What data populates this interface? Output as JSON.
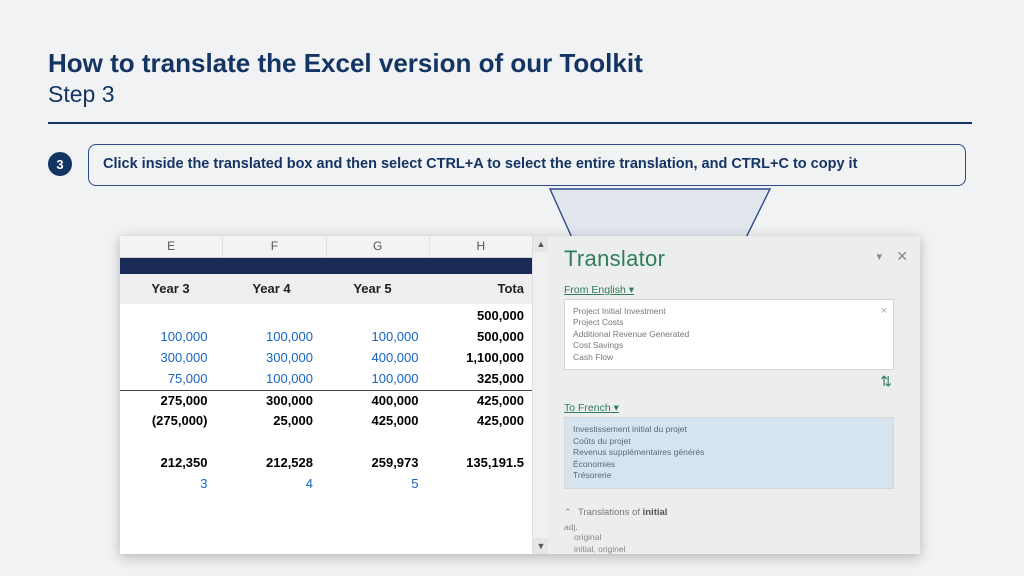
{
  "title": "How to translate the Excel version of our Toolkit",
  "subtitle": "Step 3",
  "step_number": "3",
  "instruction": "Click inside the translated box and then select CTRL+A to select the entire translation, and CTRL+C to copy it",
  "grid": {
    "col_letters": [
      "E",
      "F",
      "G",
      "H"
    ],
    "headers": [
      "Year 3",
      "Year 4",
      "Year 5",
      "Tota"
    ],
    "rows": [
      {
        "cells": [
          "",
          "",
          "",
          "500,000"
        ],
        "style": "bold"
      },
      {
        "cells": [
          "100,000",
          "100,000",
          "100,000",
          "500,000"
        ],
        "style": "blue"
      },
      {
        "cells": [
          "300,000",
          "300,000",
          "400,000",
          "1,100,000"
        ],
        "style": "blue"
      },
      {
        "cells": [
          "75,000",
          "100,000",
          "100,000",
          "325,000"
        ],
        "style": "blue"
      },
      {
        "cells": [
          "275,000",
          "300,000",
          "400,000",
          "425,000"
        ],
        "style": "bold",
        "sep": true
      },
      {
        "cells": [
          "(275,000)",
          "25,000",
          "425,000",
          "425,000"
        ],
        "style": "bold"
      },
      {
        "cells": [
          "",
          "",
          "",
          ""
        ],
        "style": ""
      },
      {
        "cells": [
          "212,350",
          "212,528",
          "259,973",
          "135,191.5"
        ],
        "style": "bold"
      },
      {
        "cells": [
          "3",
          "4",
          "5",
          ""
        ],
        "style": "blue"
      }
    ]
  },
  "translator": {
    "title": "Translator",
    "from_label_prefix": "From ",
    "from_lang": "English",
    "from_suffix": " ▾",
    "to_label_prefix": "To ",
    "to_lang": "French",
    "to_suffix": " ▾",
    "source_lines": [
      "Project Initial Investment",
      "Project Costs",
      "Additional Revenue Generated",
      "Cost Savings",
      "Cash Flow"
    ],
    "target_lines": [
      "Investissement initial du projet",
      "Coûts du projet",
      "Revenus supplémentaires générés",
      "Économies",
      "Trésorerie"
    ],
    "swap": "⇅",
    "dict_caret": "⌃",
    "dict_label_prefix": "Translations of ",
    "dict_headword": "initial",
    "dict_pos": "adj.",
    "dict_defs": [
      "original",
      "initial, originel"
    ]
  }
}
